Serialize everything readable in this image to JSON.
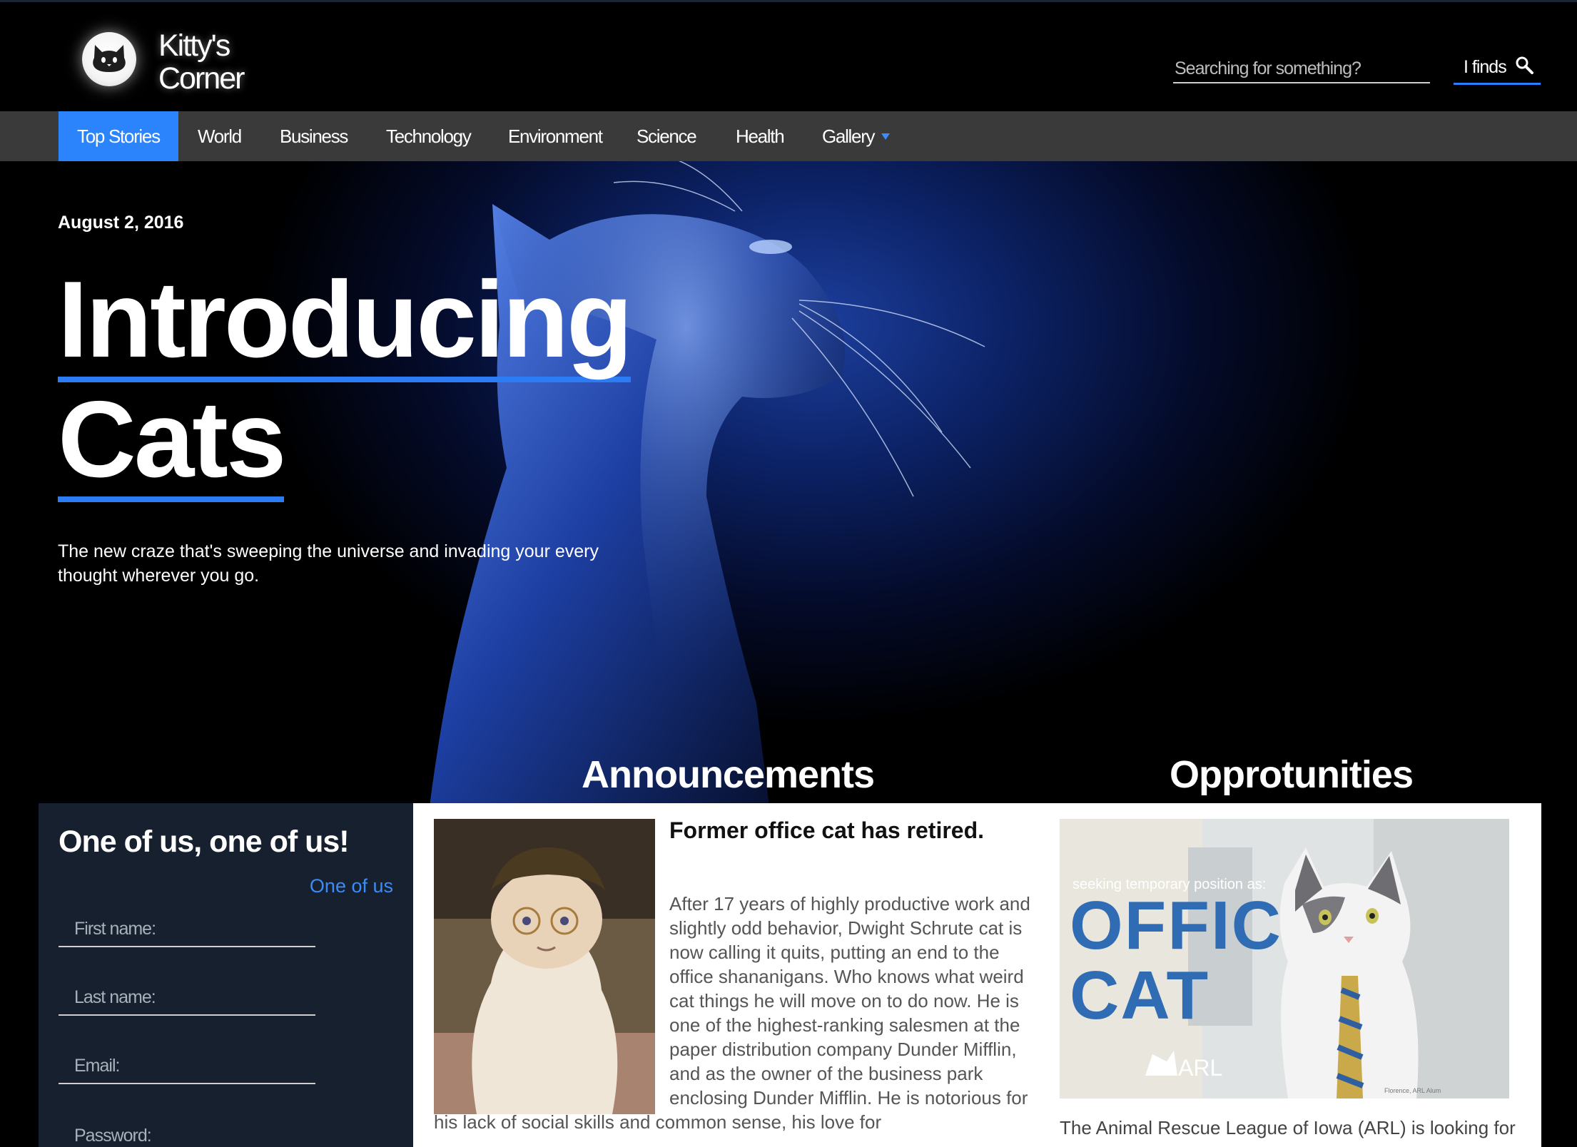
{
  "brand": {
    "line1": "Kitty's",
    "line2": "Corner"
  },
  "search": {
    "placeholder": "Searching for something?",
    "button_label": "I finds"
  },
  "nav": {
    "items": [
      {
        "label": "Top Stories",
        "active": true
      },
      {
        "label": "World"
      },
      {
        "label": "Business"
      },
      {
        "label": "Technology"
      },
      {
        "label": "Environment"
      },
      {
        "label": "Science"
      },
      {
        "label": "Health"
      },
      {
        "label": "Gallery",
        "has_dropdown": true
      }
    ]
  },
  "hero": {
    "date": "August 2, 2016",
    "headline_line1": "Introducing",
    "headline_line2": "Cats",
    "subtitle": "The new craze that's sweeping the universe and invading your every thought wherever you go."
  },
  "sections": {
    "announcements": "Announcements",
    "opportunities": "Opprotunities"
  },
  "signup": {
    "title": "One of us, one of us!",
    "link": "One of us",
    "fields": {
      "first_name": "First name:",
      "last_name": "Last name:",
      "email": "Email:",
      "password": "Password:"
    }
  },
  "announcement": {
    "title": "Former office cat has retired.",
    "body": "After 17 years of highly productive work and slightly odd behavior, Dwight Schrute cat is now calling it quits, putting an end to the office shananigans. Who knows what weird cat things he will move on to do now. He is one of the highest-ranking salesmen at the paper distribution company Dunder Mifflin, and as the owner of the business park enclosing Dunder Mifflin. He is notorious for his lack of social skills and common sense, his love for"
  },
  "opportunity": {
    "poster_top": "seeking temporary position as:",
    "poster_line1": "OFFICE",
    "poster_line2": "CAT",
    "poster_logo": "ARL",
    "poster_credit": "Florence, ARL Alum",
    "text": "The Animal Rescue League of Iowa (ARL) is looking for"
  },
  "colors": {
    "accent": "#2b84fb",
    "nav_bg": "#3a3a3a",
    "signup_bg": "#16202e"
  }
}
